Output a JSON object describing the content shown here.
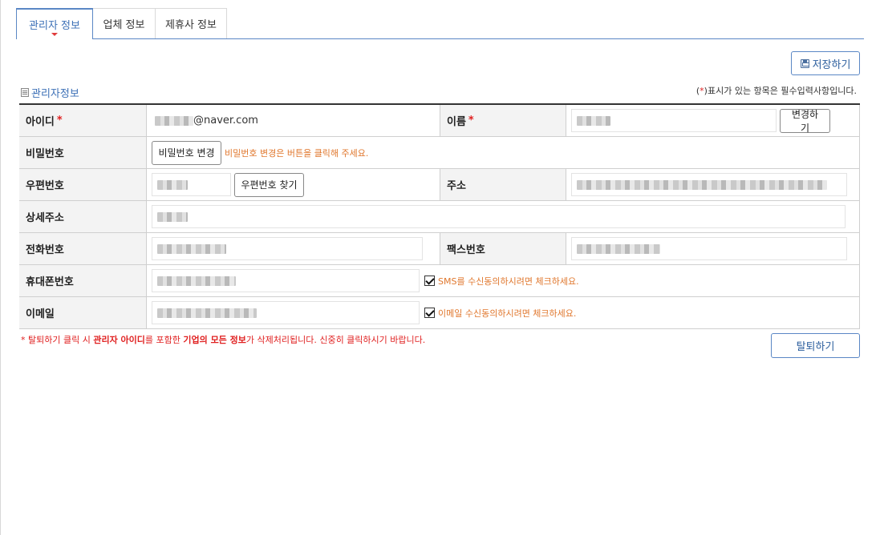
{
  "tabs": [
    {
      "label": "관리자 정보",
      "active": true
    },
    {
      "label": "업체 정보",
      "active": false
    },
    {
      "label": "제휴사 정보",
      "active": false
    }
  ],
  "toolbar": {
    "save_label": "저장하기"
  },
  "section": {
    "title": "관리자정보",
    "required_note_open": "(",
    "required_note_star": "*",
    "required_note_rest": ")표시가 있는 항목은 필수입력사항입니다."
  },
  "form": {
    "id": {
      "label": "아이디",
      "required_mark": "*",
      "value_suffix": "@naver.com"
    },
    "name": {
      "label": "이름",
      "required_mark": "*",
      "change_button": "변경하기"
    },
    "password": {
      "label": "비밀번호",
      "change_button": "비밀번호 변경",
      "hint": "비밀번호 변경은 버튼을 클릭해 주세요."
    },
    "zipcode": {
      "label": "우편번호",
      "find_button": "우편번호 찾기"
    },
    "address": {
      "label": "주소"
    },
    "address_detail": {
      "label": "상세주소"
    },
    "phone": {
      "label": "전화번호"
    },
    "fax": {
      "label": "팩스번호"
    },
    "mobile": {
      "label": "휴대폰번호",
      "sms_consent_checked": true,
      "sms_hint": "SMS를 수신동의하시려면 체크하세요."
    },
    "email": {
      "label": "이메일",
      "email_consent_checked": true,
      "email_hint": "이메일 수신동의하시려면 체크하세요."
    }
  },
  "footer": {
    "warn_star": "*",
    "warn_part1": " 탈퇴하기 클릭 시 ",
    "warn_bold1": "관리자 아이디",
    "warn_part2": "를 포함한 ",
    "warn_bold2": "기업의 모든 정보",
    "warn_part3": "가 삭제처리됩니다. 신중히 클릭하시기 바랍니다.",
    "withdraw_label": "탈퇴하기"
  },
  "colors": {
    "accent": "#3b6fb6",
    "required": "#e02020",
    "hint": "#e0772d"
  }
}
